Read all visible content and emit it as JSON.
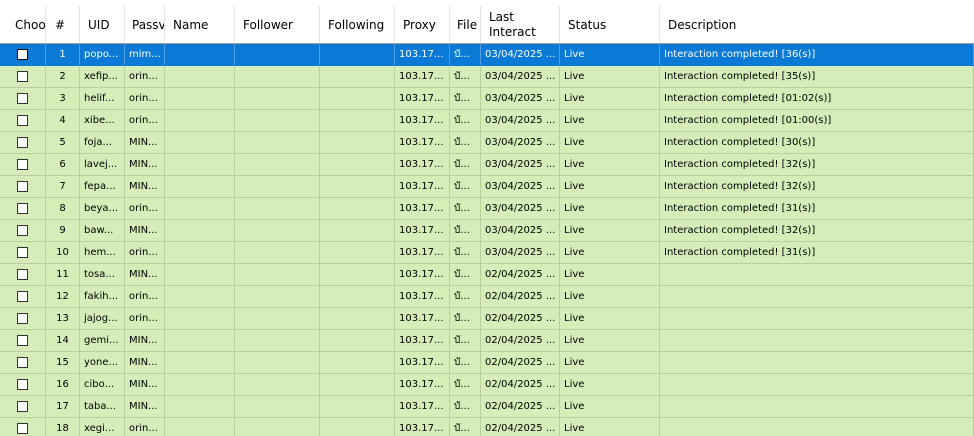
{
  "columns": {
    "choose": "Choo",
    "index": "#",
    "uid": "UID",
    "password": "Passv",
    "name": "Name",
    "follower": "Follower",
    "following": "Following",
    "proxy": "Proxy",
    "file": "File",
    "last_interact": "Last Interact",
    "status": "Status",
    "description": "Description"
  },
  "rows": [
    {
      "index": "1",
      "uid": "popo...",
      "password": "mim...",
      "name": "",
      "follower": "",
      "following": "",
      "proxy": "103.17...",
      "file": "บั...",
      "last_interact": "03/04/2025 ...",
      "status": "Live",
      "description": "Interaction completed! [36(s)]",
      "selected": true
    },
    {
      "index": "2",
      "uid": "xefip...",
      "password": "orin...",
      "name": "",
      "follower": "",
      "following": "",
      "proxy": "103.17...",
      "file": "บั...",
      "last_interact": "03/04/2025 ...",
      "status": "Live",
      "description": "Interaction completed! [35(s)]"
    },
    {
      "index": "3",
      "uid": "helif...",
      "password": "orin...",
      "name": "",
      "follower": "",
      "following": "",
      "proxy": "103.17...",
      "file": "บั...",
      "last_interact": "03/04/2025 ...",
      "status": "Live",
      "description": "Interaction completed! [01:02(s)]"
    },
    {
      "index": "4",
      "uid": "xibe...",
      "password": "orin...",
      "name": "",
      "follower": "",
      "following": "",
      "proxy": "103.17...",
      "file": "บั...",
      "last_interact": "03/04/2025 ...",
      "status": "Live",
      "description": "Interaction completed! [01:00(s)]"
    },
    {
      "index": "5",
      "uid": "foja...",
      "password": "MIN...",
      "name": "",
      "follower": "",
      "following": "",
      "proxy": "103.17...",
      "file": "บั...",
      "last_interact": "03/04/2025 ...",
      "status": "Live",
      "description": "Interaction completed! [30(s)]"
    },
    {
      "index": "6",
      "uid": "lavej...",
      "password": "MIN...",
      "name": "",
      "follower": "",
      "following": "",
      "proxy": "103.17...",
      "file": "บั...",
      "last_interact": "03/04/2025 ...",
      "status": "Live",
      "description": "Interaction completed! [32(s)]"
    },
    {
      "index": "7",
      "uid": "fepa...",
      "password": "MIN...",
      "name": "",
      "follower": "",
      "following": "",
      "proxy": "103.17...",
      "file": "บั...",
      "last_interact": "03/04/2025 ...",
      "status": "Live",
      "description": "Interaction completed! [32(s)]"
    },
    {
      "index": "8",
      "uid": "beya...",
      "password": "orin...",
      "name": "",
      "follower": "",
      "following": "",
      "proxy": "103.17...",
      "file": "บั...",
      "last_interact": "03/04/2025 ...",
      "status": "Live",
      "description": "Interaction completed! [31(s)]"
    },
    {
      "index": "9",
      "uid": "baw...",
      "password": "MIN...",
      "name": "",
      "follower": "",
      "following": "",
      "proxy": "103.17...",
      "file": "บั...",
      "last_interact": "03/04/2025 ...",
      "status": "Live",
      "description": "Interaction completed! [32(s)]"
    },
    {
      "index": "10",
      "uid": "hem...",
      "password": "orin...",
      "name": "",
      "follower": "",
      "following": "",
      "proxy": "103.17...",
      "file": "บั...",
      "last_interact": "03/04/2025 ...",
      "status": "Live",
      "description": "Interaction completed! [31(s)]"
    },
    {
      "index": "11",
      "uid": "tosa...",
      "password": "MIN...",
      "name": "",
      "follower": "",
      "following": "",
      "proxy": "103.17...",
      "file": "บั...",
      "last_interact": "02/04/2025 ...",
      "status": "Live",
      "description": ""
    },
    {
      "index": "12",
      "uid": "fakih...",
      "password": "orin...",
      "name": "",
      "follower": "",
      "following": "",
      "proxy": "103.17...",
      "file": "บั...",
      "last_interact": "02/04/2025 ...",
      "status": "Live",
      "description": ""
    },
    {
      "index": "13",
      "uid": "jajog...",
      "password": "orin...",
      "name": "",
      "follower": "",
      "following": "",
      "proxy": "103.17...",
      "file": "บั...",
      "last_interact": "02/04/2025 ...",
      "status": "Live",
      "description": ""
    },
    {
      "index": "14",
      "uid": "gemi...",
      "password": "MIN...",
      "name": "",
      "follower": "",
      "following": "",
      "proxy": "103.17...",
      "file": "บั...",
      "last_interact": "02/04/2025 ...",
      "status": "Live",
      "description": ""
    },
    {
      "index": "15",
      "uid": "yone...",
      "password": "MIN...",
      "name": "",
      "follower": "",
      "following": "",
      "proxy": "103.17...",
      "file": "บั...",
      "last_interact": "02/04/2025 ...",
      "status": "Live",
      "description": ""
    },
    {
      "index": "16",
      "uid": "cibo...",
      "password": "MIN...",
      "name": "",
      "follower": "",
      "following": "",
      "proxy": "103.17...",
      "file": "บั...",
      "last_interact": "02/04/2025 ...",
      "status": "Live",
      "description": ""
    },
    {
      "index": "17",
      "uid": "taba...",
      "password": "MIN...",
      "name": "",
      "follower": "",
      "following": "",
      "proxy": "103.17...",
      "file": "บั...",
      "last_interact": "02/04/2025 ...",
      "status": "Live",
      "description": ""
    },
    {
      "index": "18",
      "uid": "xegi...",
      "password": "orin...",
      "name": "",
      "follower": "",
      "following": "",
      "proxy": "103.17...",
      "file": "บั...",
      "last_interact": "02/04/2025 ...",
      "status": "Live",
      "description": ""
    }
  ],
  "colors": {
    "row_bg": "#d4edb9",
    "selected_bg": "#0a7ad6"
  }
}
